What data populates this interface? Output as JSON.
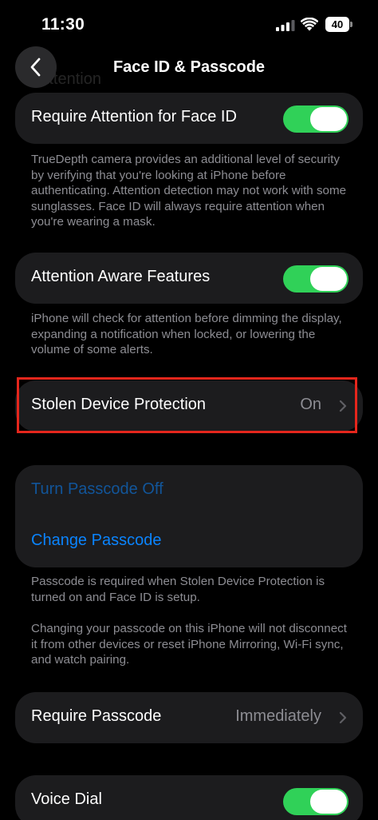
{
  "status_bar": {
    "time": "11:30",
    "battery_level": "40"
  },
  "nav": {
    "title": "Face ID & Passcode",
    "ghost_scrolled_text": "Attention"
  },
  "attention_group": {
    "label": "Require Attention for Face ID",
    "toggle_on": true,
    "footnote": "TrueDepth camera provides an additional level of security by verifying that you're looking at iPhone before authenticating. Attention detection may not work with some sunglasses. Face ID will always require attention when you're wearing a mask."
  },
  "aware_group": {
    "label": "Attention Aware Features",
    "toggle_on": true,
    "footnote": "iPhone will check for attention before dimming the display, expanding a notification when locked, or lowering the volume of some alerts."
  },
  "stolen_group": {
    "label": "Stolen Device Protection",
    "value": "On"
  },
  "passcode_group": {
    "turn_off_label": "Turn Passcode Off",
    "change_label": "Change Passcode",
    "footnote_1": "Passcode is required when Stolen Device Protection is turned on and Face ID is setup.",
    "footnote_2": "Changing your passcode on this iPhone will not disconnect it from other devices or reset iPhone Mirroring, Wi-Fi sync, and watch pairing."
  },
  "require_group": {
    "label": "Require Passcode",
    "value": "Immediately"
  },
  "voice_group": {
    "label": "Voice Dial",
    "toggle_on": true
  },
  "colors": {
    "toggle_on": "#30d158",
    "link_blue": "#0a84ff",
    "highlight_red": "#e5261c",
    "cell_background": "#1c1c1e"
  }
}
